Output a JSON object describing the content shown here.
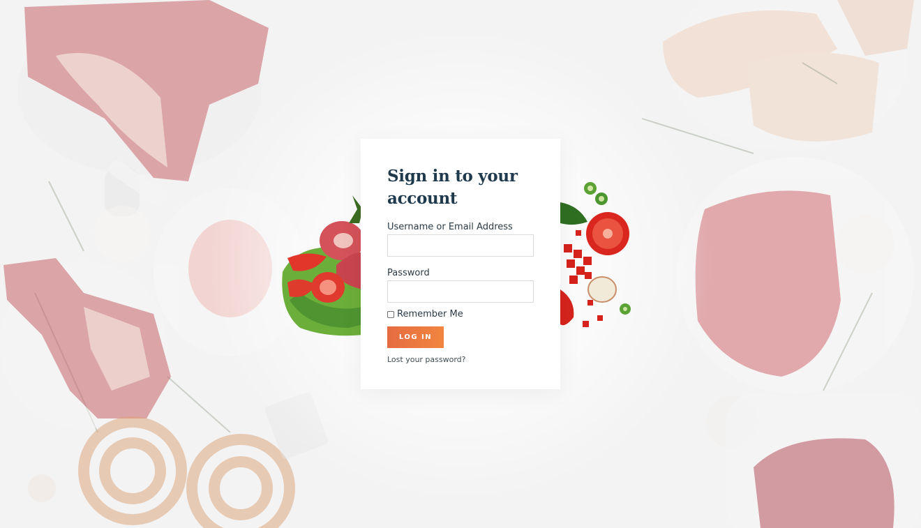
{
  "login": {
    "title": "Sign in to your account",
    "username_label": "Username or Email Address",
    "username_value": "",
    "password_label": "Password",
    "password_value": "",
    "remember_label": "Remember Me",
    "remember_checked": false,
    "submit_label": "LOG IN",
    "lost_password_label": "Lost your password?"
  },
  "colors": {
    "page_background": "#f3f3f4",
    "card_background": "#ffffff",
    "title_color": "#1f3a4d",
    "button_gradient_start": "#e56c42",
    "button_gradient_end": "#f2853f"
  },
  "background": {
    "images": [
      "t-bone-steak-on-board",
      "raw-chicken-breasts",
      "ribeye-steak-plate",
      "coiled-sausages",
      "beef-steak-plate",
      "garlic-bulbs",
      "fresh-thyme",
      "meat-with-tomato-and-lettuce",
      "chopped-tomato-and-pepper"
    ]
  }
}
